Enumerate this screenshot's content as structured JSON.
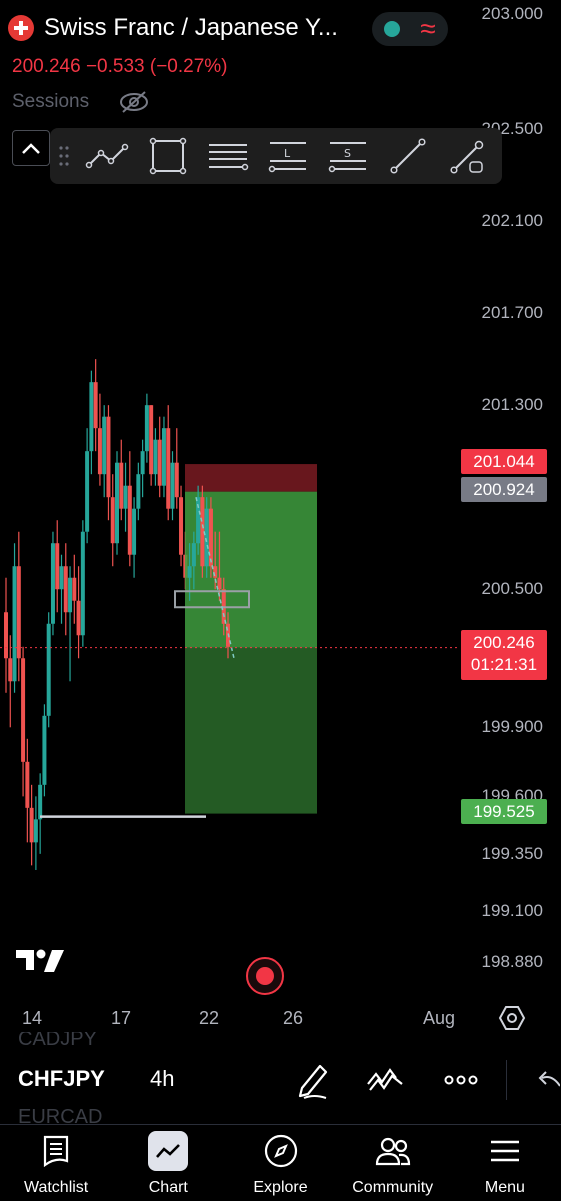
{
  "header": {
    "title": "Swiss Franc / Japanese Y...",
    "price_line": "200.246  −0.533 (−0.27%)",
    "sessions_label": "Sessions"
  },
  "toolbar": {
    "tools": [
      "trend-line",
      "rectangle",
      "parallel-channel",
      "long-position",
      "short-position",
      "line",
      "ray"
    ],
    "long_letter": "L",
    "short_letter": "S"
  },
  "chart_data": {
    "type": "candlestick",
    "symbol": "CHFJPY",
    "interval": "4h",
    "y_ticks": [
      203.0,
      202.5,
      202.1,
      201.7,
      201.3,
      200.5,
      199.9,
      199.6,
      199.35,
      199.1,
      198.88
    ],
    "y_tick_labels": [
      "203.000",
      "202.500",
      "202.100",
      "201.700",
      "201.300",
      "200.500",
      "199.900",
      "199.600",
      "199.350",
      "199.100",
      "198.880"
    ],
    "x_labels": [
      "14",
      "17",
      "22",
      "26",
      "Aug"
    ],
    "last_price": 200.246,
    "countdown": "01:21:31",
    "position": {
      "type": "short",
      "entry": 200.924,
      "stop_loss": 201.044,
      "take_profit": 199.525
    },
    "price_labels": {
      "stop_loss": "201.044",
      "entry": "200.924",
      "last": "200.246",
      "take_profit": "199.525"
    },
    "ohlc": [
      [
        200.4,
        200.55,
        200.05,
        200.2
      ],
      [
        200.2,
        200.3,
        199.9,
        200.1
      ],
      [
        200.1,
        200.7,
        200.05,
        200.6
      ],
      [
        200.6,
        200.75,
        200.1,
        200.2
      ],
      [
        200.2,
        200.25,
        199.6,
        199.75
      ],
      [
        199.75,
        199.85,
        199.4,
        199.55
      ],
      [
        199.55,
        199.65,
        199.3,
        199.4
      ],
      [
        199.4,
        199.6,
        199.28,
        199.5
      ],
      [
        199.5,
        199.7,
        199.35,
        199.65
      ],
      [
        199.65,
        200.0,
        199.6,
        199.95
      ],
      [
        199.95,
        200.4,
        199.9,
        200.35
      ],
      [
        200.35,
        200.75,
        200.3,
        200.7
      ],
      [
        200.7,
        200.8,
        200.4,
        200.5
      ],
      [
        200.5,
        200.65,
        200.35,
        200.6
      ],
      [
        200.6,
        200.7,
        200.3,
        200.4
      ],
      [
        200.4,
        200.6,
        200.1,
        200.55
      ],
      [
        200.55,
        200.65,
        200.35,
        200.45
      ],
      [
        200.45,
        200.6,
        200.2,
        200.3
      ],
      [
        200.3,
        200.8,
        200.25,
        200.75
      ],
      [
        200.75,
        201.2,
        200.7,
        201.1
      ],
      [
        201.1,
        201.45,
        201.0,
        201.4
      ],
      [
        201.4,
        201.5,
        201.1,
        201.2
      ],
      [
        201.2,
        201.35,
        200.95,
        201.0
      ],
      [
        201.0,
        201.3,
        200.9,
        201.25
      ],
      [
        201.25,
        201.3,
        200.8,
        200.9
      ],
      [
        200.9,
        201.0,
        200.6,
        200.7
      ],
      [
        200.7,
        201.1,
        200.65,
        201.05
      ],
      [
        201.05,
        201.15,
        200.8,
        200.85
      ],
      [
        200.85,
        201.05,
        200.75,
        200.95
      ],
      [
        200.95,
        201.1,
        200.6,
        200.65
      ],
      [
        200.65,
        200.9,
        200.55,
        200.85
      ],
      [
        200.85,
        201.05,
        200.8,
        201.0
      ],
      [
        201.0,
        201.15,
        200.9,
        201.1
      ],
      [
        201.1,
        201.35,
        201.05,
        201.3
      ],
      [
        201.3,
        201.3,
        200.95,
        201.0
      ],
      [
        201.0,
        201.2,
        200.95,
        201.15
      ],
      [
        201.15,
        201.25,
        200.9,
        200.95
      ],
      [
        200.95,
        201.25,
        200.9,
        201.2
      ],
      [
        201.2,
        201.3,
        200.8,
        200.85
      ],
      [
        200.85,
        201.1,
        200.8,
        201.05
      ],
      [
        201.05,
        201.2,
        200.85,
        200.9
      ],
      [
        200.9,
        200.95,
        200.6,
        200.65
      ],
      [
        200.65,
        200.75,
        200.5,
        200.55
      ],
      [
        200.55,
        200.7,
        200.45,
        200.6
      ],
      [
        200.6,
        200.75,
        200.5,
        200.7
      ],
      [
        200.7,
        200.95,
        200.65,
        200.9
      ],
      [
        200.9,
        200.95,
        200.55,
        200.6
      ],
      [
        200.6,
        200.9,
        200.55,
        200.85
      ],
      [
        200.85,
        200.9,
        200.55,
        200.6
      ],
      [
        200.6,
        200.75,
        200.5,
        200.55
      ],
      [
        200.55,
        200.75,
        200.45,
        200.5
      ],
      [
        200.5,
        200.55,
        200.3,
        200.35
      ],
      [
        200.35,
        200.4,
        200.2,
        200.25
      ]
    ]
  },
  "symbol_bar": {
    "prev_symbol": "CADJPY",
    "symbol": "CHFJPY",
    "next_symbol": "EURCAD",
    "interval": "4h"
  },
  "nav": {
    "items": [
      {
        "label": "Watchlist",
        "icon": "watchlist-icon"
      },
      {
        "label": "Chart",
        "icon": "chart-icon"
      },
      {
        "label": "Explore",
        "icon": "compass-icon"
      },
      {
        "label": "Community",
        "icon": "community-icon"
      },
      {
        "label": "Menu",
        "icon": "menu-icon"
      }
    ]
  },
  "colors": {
    "up": "#26a69a",
    "down": "#ef5350",
    "profit_zone": "#4caf50",
    "loss_zone": "#f23645",
    "background": "#000000"
  }
}
